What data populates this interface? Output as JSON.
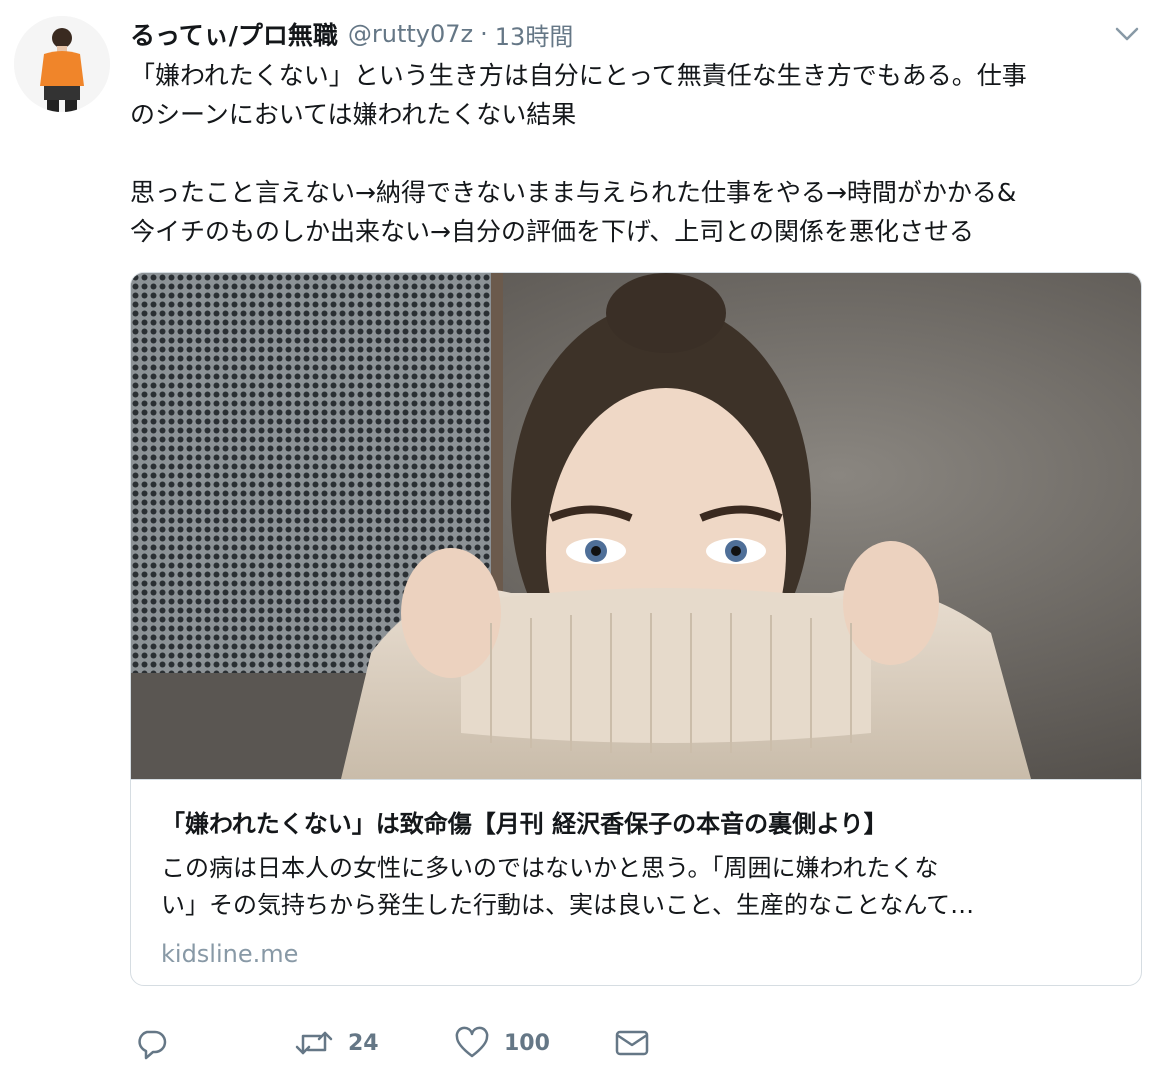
{
  "tweet": {
    "display_name": "るってぃ/プロ無職",
    "handle": "@rutty07z",
    "separator": "·",
    "timestamp": "13時間",
    "text_lines": [
      "「嫌われたくない」という生き方は自分にとって無責任な生き方でもある。仕事",
      "のシーンにおいては嫌われたくない結果",
      "",
      "思ったこと言えない→納得できないまま与えられた仕事をやる→時間がかかる&",
      "今イチのものしか出来ない→自分の評価を下げ、上司との関係を悪化させる"
    ]
  },
  "card": {
    "title": "「嫌われたくない」は致命傷【月刊 経沢香保子の本音の裏側より】",
    "description_lines": [
      "この病は日本人の女性に多いのではないかと思う。「周囲に嫌われたくな",
      "い」その気持ちから発生した行動は、実は良いこと、生産的なことなんて…"
    ],
    "domain": "kidsline.me"
  },
  "actions": {
    "reply_icon": "reply-icon",
    "retweet_icon": "retweet-icon",
    "retweet_count": "24",
    "like_icon": "heart-icon",
    "like_count": "100",
    "dm_icon": "envelope-icon"
  },
  "colors": {
    "text": "#14171a",
    "secondary": "#657786",
    "border": "#d6dde2",
    "domain": "#8899a6",
    "avatar_shirt": "#f0852a"
  }
}
